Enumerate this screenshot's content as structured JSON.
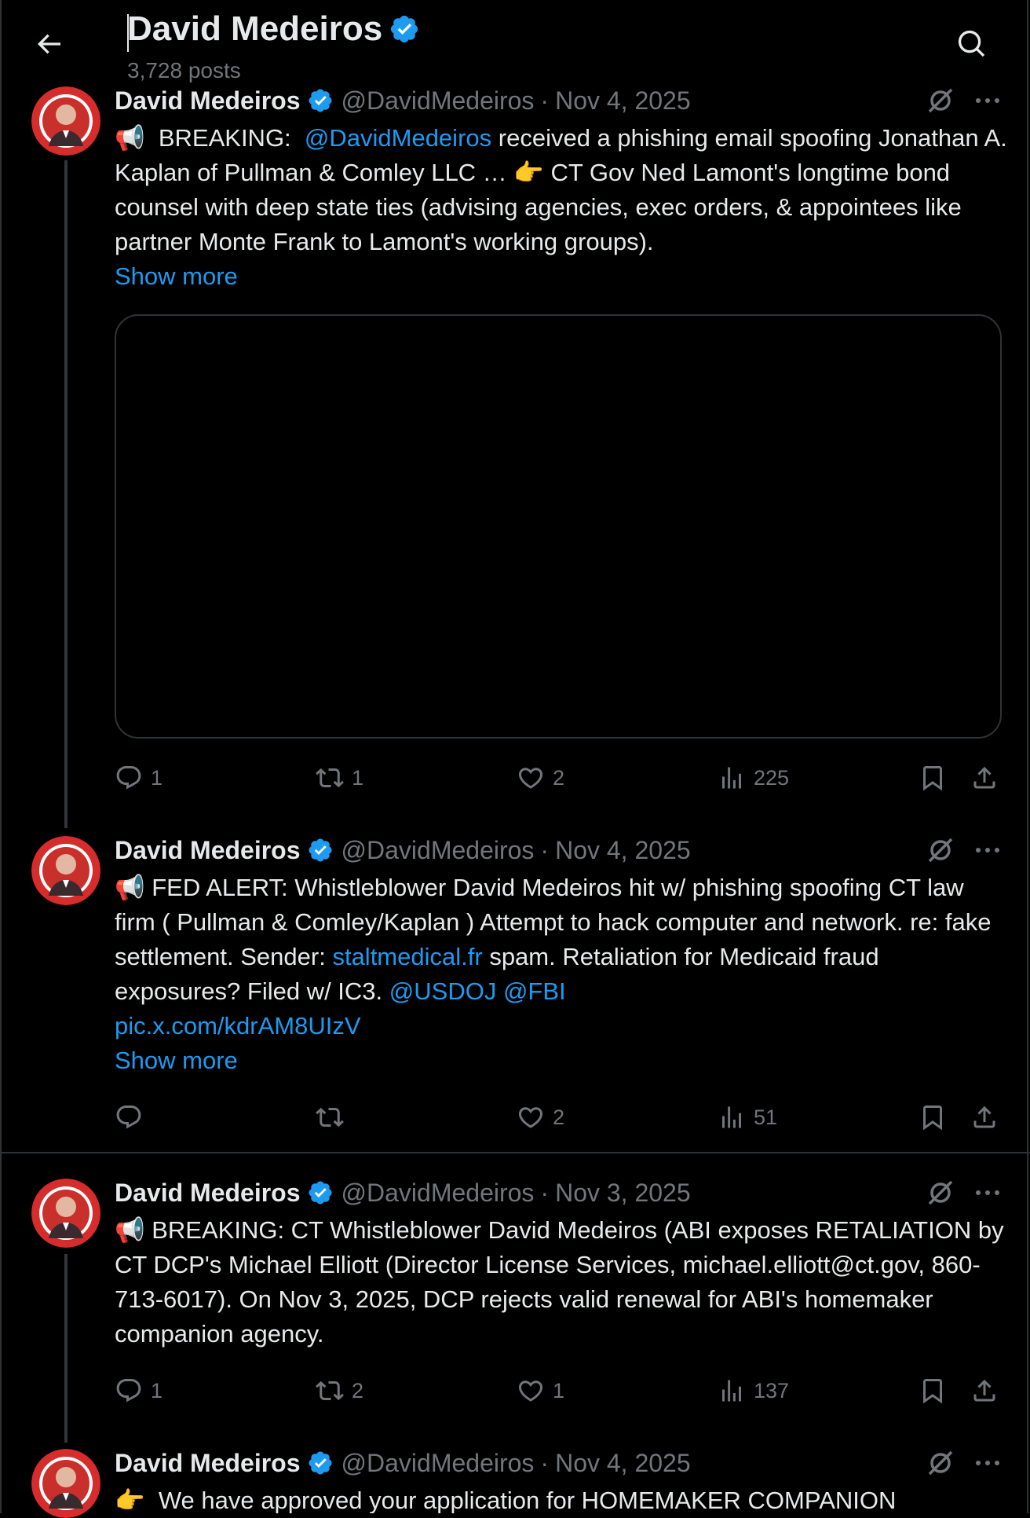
{
  "header": {
    "back_icon": "arrow-left-icon",
    "title": "David Medeiros",
    "posts": "3,728 posts",
    "search_icon": "search-icon"
  },
  "colors": {
    "background": "#000000",
    "link": "#1d9bf0",
    "muted": "#71767b",
    "text": "#e7e9ea",
    "verified": "#1d9bf0"
  },
  "tweets": [
    {
      "name": "David Medeiros",
      "handle": "@DavidMedeiros",
      "dot": "·",
      "date": "Nov 4, 2025",
      "body_parts": {
        "emoji1": "📢",
        "t1": "BREAKING:",
        "mention": "@DavidMedeiros",
        "t2": "received a phishing email spoofing Jonathan A. Kaplan of Pullman & Comley LLC …",
        "emoji2": "👉",
        "t3": "CT Gov Ned Lamont's longtime bond counsel with deep state ties (advising agencies, exec orders, & appointees like partner Monte Frank to Lamont's working groups)."
      },
      "show_more": "Show more",
      "stats": {
        "replies": "1",
        "reposts": "1",
        "likes": "2",
        "views": "225"
      }
    },
    {
      "name": "David Medeiros",
      "handle": "@DavidMedeiros",
      "dot": "·",
      "date": "Nov 4, 2025",
      "body_parts": {
        "emoji1": "📢",
        "t1": "FED ALERT:  Whistleblower David Medeiros hit w/ phishing spoofing CT law firm ( Pullman & Comley/Kaplan ) Attempt to hack computer and network. re: fake settlement. Sender:",
        "link1": "staltmedical.fr",
        "t2": "spam. Retaliation for Medicaid fraud exposures? Filed w/ IC3.",
        "mention1": "@USDOJ",
        "mention2": "@FBI",
        "pic": "pic.x.com/kdrAM8UIzV"
      },
      "show_more": "Show more",
      "stats": {
        "replies": "",
        "reposts": "",
        "likes": "2",
        "views": "51"
      }
    },
    {
      "name": "David Medeiros",
      "handle": "@DavidMedeiros",
      "dot": "·",
      "date": "Nov 3, 2025",
      "body_parts": {
        "emoji1": "📢",
        "t1": "BREAKING: CT Whistleblower David Medeiros (ABI exposes RETALIATION by CT DCP's Michael Elliott (Director License Services, michael.elliott@ct.gov, 860-713-6017). On Nov 3, 2025, DCP rejects valid renewal for ABI's homemaker companion agency."
      },
      "stats": {
        "replies": "1",
        "reposts": "2",
        "likes": "1",
        "views": "137"
      }
    },
    {
      "name": "David Medeiros",
      "handle": "@DavidMedeiros",
      "dot": "·",
      "date": "Nov 4, 2025",
      "body_parts": {
        "emoji1": "👉",
        "t1": "We have approved your application for HOMEMAKER COMPANION"
      }
    }
  ]
}
